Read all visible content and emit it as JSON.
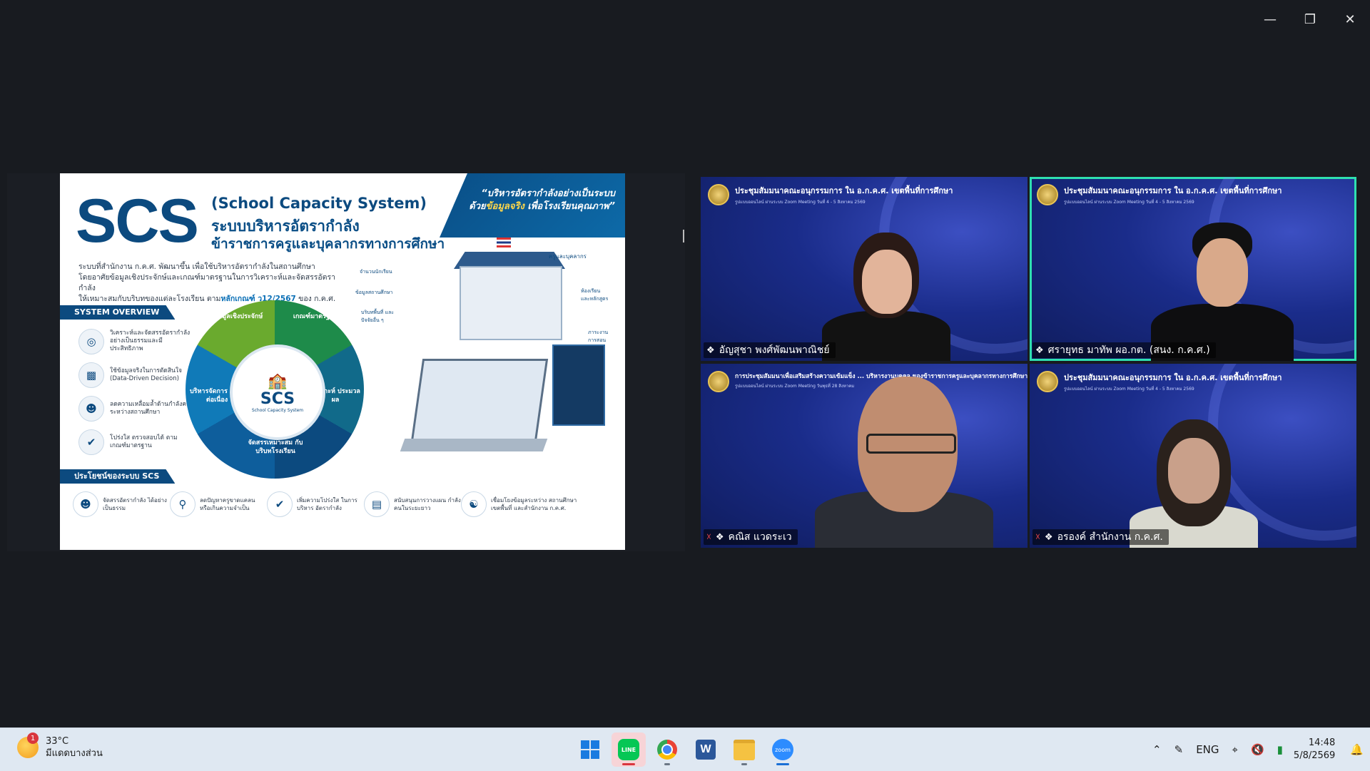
{
  "window": {
    "minimize_icon": "minimize-icon",
    "restore_icon": "restore-icon",
    "close_icon": "close-icon"
  },
  "slide": {
    "logo": "SCS",
    "subtitle": "(School Capacity System)",
    "title_line1": "ระบบบริหารอัตรากำลัง",
    "title_line2": "ข้าราชการครูและบุคลากรทางการศึกษา",
    "quote_line1": "“บริหารอัตรากำลังอย่างเป็นระบบ",
    "quote_line2_pre": "ด้วย",
    "quote_line2_hl": "ข้อมูลจริง",
    "quote_line2_post": " เพื่อโรงเรียนคุณภาพ”",
    "desc_line1": "ระบบที่สำนักงาน ก.ค.ศ. พัฒนาขึ้น เพื่อใช้บริหารอัตรากำลังในสถานศึกษา",
    "desc_line2": "โดยอาศัยข้อมูลเชิงประจักษ์และเกณฑ์มาตรฐานในการวิเคราะห์และจัดสรรอัตรากำลัง",
    "desc_line3_pre": "ให้เหมาะสมกับบริบทของแต่ละโรงเรียน ตาม",
    "desc_line3_hl": "หลักเกณฑ์ ว12/2567",
    "desc_line3_post": " ของ ก.ค.ศ.",
    "overview_title": "SYSTEM OVERVIEW",
    "overview_items": [
      "วิเคราะห์และจัดสรรอัตรากำลัง อย่างเป็นธรรมและมีประสิทธิภาพ",
      "ใช้ข้อมูลจริงในการตัดสินใจ (Data-Driven Decision)",
      "ลดความเหลื่อมล้ำด้านกำลังคน ระหว่างสถานศึกษา",
      "โปร่งใส ตรวจสอบได้ ตามเกณฑ์มาตรฐาน"
    ],
    "wheel_center": "SCS",
    "wheel_center_sub": "School Capacity System",
    "wheel_segments": [
      "ข้อมูลเชิงประจักษ์",
      "เกณฑ์มาตรฐาน",
      "วิเคราะห์ ประมวลผล",
      "จัดสรรเหมาะสม กับบริบทโรงเรียน",
      "บริหารจัดการ อย่างต่อเนื่อง"
    ],
    "illus_labels": [
      "ครูและบุคลากร",
      "ห้องเรียน และหลักสูตร",
      "ภาระงาน การสอน",
      "จำนวนนักเรียน",
      "ข้อมูลสถานศึกษา",
      "บริบทพื้นที่ และปัจจัยอื่น ๆ"
    ],
    "benefits_title": "ประโยชน์ของระบบ SCS",
    "benefits": [
      "จัดสรรอัตรากำลัง ได้อย่างเป็นธรรม",
      "ลดปัญหาครูขาดแคลน หรือเกินความจำเป็น",
      "เพิ่มความโปร่งใส ในการบริหาร อัตรากำลัง",
      "สนับสนุนการวางแผน กำลังคนในระยะยาว",
      "เชื่อมโยงข้อมูลระหว่าง สถานศึกษา เขตพื้นที่ และสำนักงาน ก.ค.ศ."
    ]
  },
  "participants": [
    {
      "name": "อัญสุชา พงศ์พัฒนพาณิชย์",
      "banner": "ประชุมสัมมนาคณะอนุกรรมการ ใน อ.ก.ค.ศ. เขตพื้นที่การศึกษา",
      "banner_sub": "รูปแบบออนไลน์ ผ่านระบบ Zoom Meeting วันที่ 4 - 5 สิงหาคม 2569",
      "muted": false,
      "active": false
    },
    {
      "name": "ศรายุทธ มาทัพ ผอ.กต. (สนง. ก.ค.ศ.)",
      "banner": "ประชุมสัมมนาคณะอนุกรรมการ ใน อ.ก.ค.ศ. เขตพื้นที่การศึกษา",
      "banner_sub": "รูปแบบออนไลน์ ผ่านระบบ Zoom Meeting วันที่ 4 - 5 สิงหาคม 2569",
      "muted": false,
      "active": true
    },
    {
      "name": "คณิส แวดระเว",
      "banner": "การประชุมสัมมนาเพื่อเสริมสร้างความเข้มแข็ง ... บริหารงานบุคคล ของข้าราชการครูและบุคลากรทางการศึกษา",
      "banner_sub": "รูปแบบออนไลน์ ผ่านระบบ Zoom Meeting วันพุธที่ 28 สิงหาคม",
      "muted": true,
      "active": false
    },
    {
      "name": "อรองค์ สำนักงาน ก.ค.ศ.",
      "banner": "ประชุมสัมมนาคณะอนุกรรมการ ใน อ.ก.ค.ศ. เขตพื้นที่การศึกษา",
      "banner_sub": "รูปแบบออนไลน์ ผ่านระบบ Zoom Meeting วันที่ 4 - 5 สิงหาคม 2569",
      "muted": true,
      "active": false
    }
  ],
  "taskbar": {
    "weather_temp": "33°C",
    "weather_desc": "มีแดดบางส่วน",
    "weather_badge": "1",
    "apps": [
      "start-button",
      "line-app",
      "chrome-app",
      "word-app",
      "file-explorer-app",
      "zoom-app"
    ],
    "lang": "ENG",
    "time": "14:48",
    "date": "5/8/2569"
  }
}
